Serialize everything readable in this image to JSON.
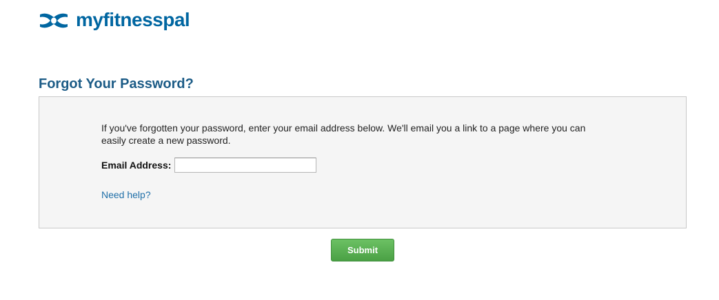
{
  "brand": {
    "name": "myfitnesspal",
    "color": "#0066a1"
  },
  "page": {
    "title": "Forgot Your Password?",
    "title_color": "#1b5b86"
  },
  "form": {
    "instructions": "If you've forgotten your password, enter your email address below. We'll email you a link to a page where you can easily create a new password.",
    "email_label": "Email Address:",
    "email_value": "",
    "help_link": "Need help?",
    "help_link_color": "#1f6fa8",
    "box_background": "#f5f5f5"
  },
  "actions": {
    "submit_label": "Submit",
    "submit_color": "#4aa045"
  }
}
